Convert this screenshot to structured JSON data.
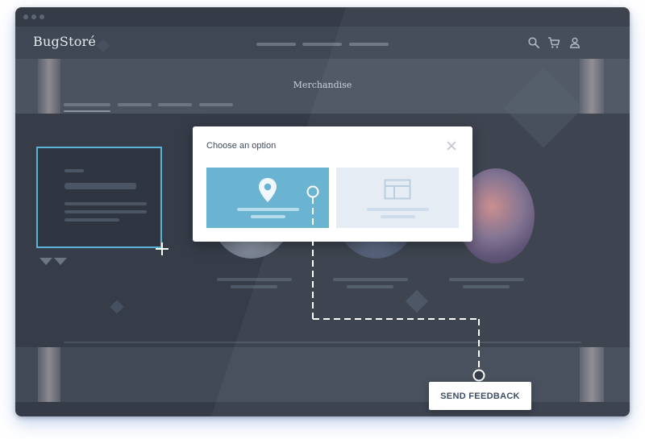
{
  "app": {
    "brand": "BugStoré"
  },
  "header": {
    "nav_links": [
      "",
      "",
      ""
    ],
    "icons": [
      "search-icon",
      "cart-icon",
      "user-icon"
    ]
  },
  "hero": {
    "title": "Merchandise"
  },
  "modal": {
    "title": "Choose an option",
    "close_icon": "close-icon",
    "options": [
      {
        "icon": "location-pin-icon",
        "state": "selected",
        "color": "#6ab4d2"
      },
      {
        "icon": "layout-icon",
        "state": "unselected",
        "color": "#e6ecf3"
      }
    ]
  },
  "feedback": {
    "button_label": "SEND FEEDBACK"
  },
  "colors": {
    "accent": "#6ab4d2",
    "selection_outline": "#5ab4d6",
    "page_background": "#3b4350",
    "button_text": "#3d4d66"
  }
}
